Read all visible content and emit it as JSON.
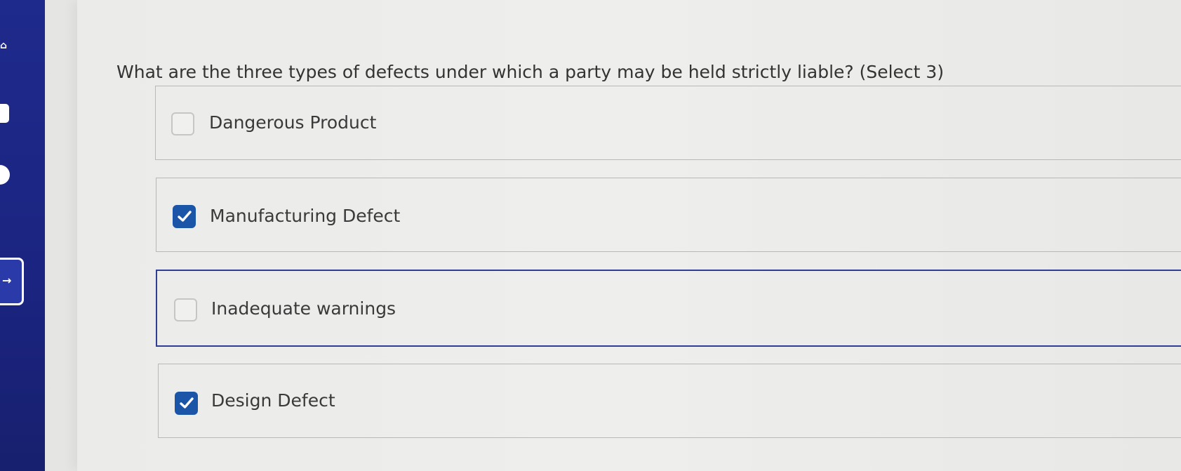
{
  "question": {
    "text": "What are the three types of defects under which a party may be held strictly liable? (Select 3)"
  },
  "options": [
    {
      "label": "Dangerous Product",
      "checked": false
    },
    {
      "label": "Manufacturing Defect",
      "checked": true
    },
    {
      "label": "Inadequate warnings",
      "checked": false,
      "focused": true
    },
    {
      "label": "Design Defect",
      "checked": true
    }
  ],
  "colors": {
    "sidebar": "#1e2a8c",
    "checkbox_checked": "#1a55a8",
    "focus_border": "#2f3d93"
  }
}
